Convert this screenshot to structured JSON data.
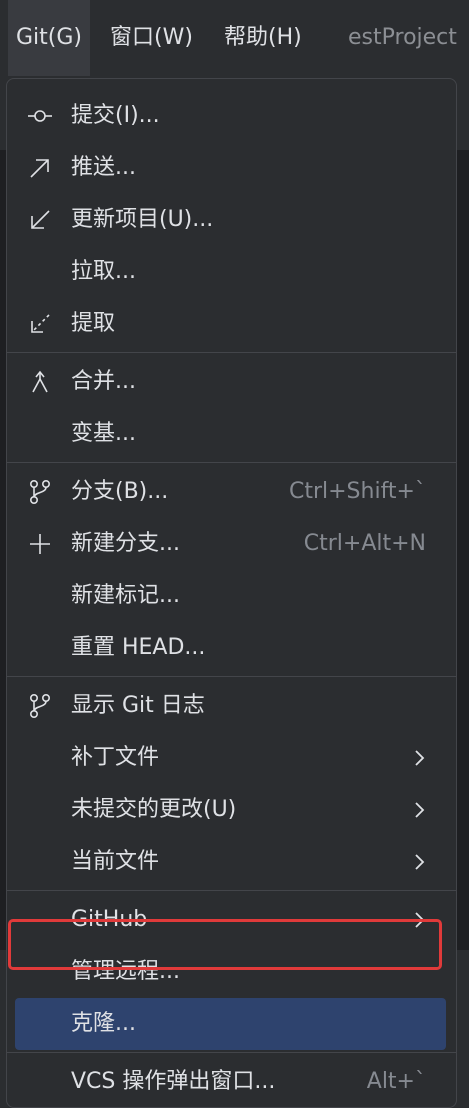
{
  "menubar": {
    "git": "Git(G)",
    "window": "窗口(W)",
    "help": "帮助(H)",
    "project_title": "estProject"
  },
  "groups": [
    {
      "items": [
        {
          "label": "提交(I)...",
          "icon": "commit-icon"
        },
        {
          "label": "推送...",
          "icon": "push-arrow-icon"
        },
        {
          "label": "更新项目(U)...",
          "icon": "update-arrow-icon"
        },
        {
          "label": "拉取...",
          "icon": ""
        },
        {
          "label": "提取",
          "icon": "fetch-icon"
        }
      ]
    },
    {
      "items": [
        {
          "label": "合并...",
          "icon": "merge-icon"
        },
        {
          "label": "变基...",
          "icon": ""
        }
      ]
    },
    {
      "items": [
        {
          "label": "分支(B)...",
          "icon": "branch-icon",
          "shortcut": "Ctrl+Shift+`"
        },
        {
          "label": "新建分支...",
          "icon": "plus-icon",
          "shortcut": "Ctrl+Alt+N"
        },
        {
          "label": "新建标记...",
          "icon": ""
        },
        {
          "label": "重置 HEAD...",
          "icon": ""
        }
      ]
    },
    {
      "items": [
        {
          "label": "显示 Git 日志",
          "icon": "branch-icon"
        },
        {
          "label": "补丁文件",
          "icon": "",
          "submenu": true
        },
        {
          "label": "未提交的更改(U)",
          "icon": "",
          "submenu": true
        },
        {
          "label": "当前文件",
          "icon": "",
          "submenu": true
        }
      ]
    },
    {
      "items": [
        {
          "label": "GitHub",
          "icon": "",
          "submenu": true
        },
        {
          "label": "管理远程...",
          "icon": ""
        },
        {
          "label": "克隆...",
          "icon": "",
          "selected": true
        }
      ]
    },
    {
      "items": [
        {
          "label": "VCS 操作弹出窗口...",
          "icon": "",
          "shortcut": "Alt+`"
        }
      ]
    }
  ],
  "colors": {
    "menu_bg": "#2b2d30",
    "selected_bg": "#2e436e",
    "highlight_border": "#e03a3a",
    "text": "#dfe1e5",
    "shortcut_text": "#868a91"
  }
}
